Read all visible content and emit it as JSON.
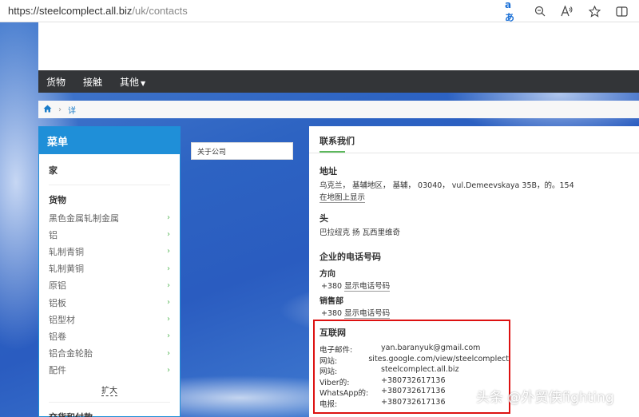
{
  "browser": {
    "url_domain": "https://steelcomplect.all.biz",
    "url_path": "/uk/contacts",
    "icons": [
      "translate-icon",
      "zoom-icon",
      "read-aloud-icon",
      "favorite-icon",
      "split-screen-icon"
    ],
    "translate_label": "aあ"
  },
  "nav": {
    "items": [
      "货物",
      "接触",
      "其他"
    ]
  },
  "breadcrumb": {
    "current": "详"
  },
  "menu": {
    "title": "菜单",
    "home": "家",
    "category": "货物",
    "items": [
      "黑色金属轧制金属",
      "铝",
      "轧制青铜",
      "轧制黄铜",
      "原铝",
      "铝板",
      "铝型材",
      "铝卷",
      "铝合金轮胎",
      "配件"
    ],
    "expand": "扩大",
    "category2": "交货和付款"
  },
  "about": {
    "label": "关于公司"
  },
  "contacts": {
    "title": "联系我们",
    "address_heading": "地址",
    "address": "乌克兰， 基辅地区， 基辅， 03040， vul.Demeevskaya 35B，的。154",
    "map_link": "在地图上显示",
    "head_heading": "头",
    "head_name": "巴拉纽克 扬 瓦西里维奇",
    "phones_heading": "企业的电话号码",
    "direction_label": "方向",
    "direction_prefix": "+380",
    "direction_link": "显示电话号码",
    "sales_label": "销售部",
    "sales_prefix": "+380",
    "sales_link": "显示电话号码",
    "internet_heading": "互联网",
    "internet": [
      {
        "label": "电子邮件:",
        "value": "yan.baranyuk@gmail.com"
      },
      {
        "label": "网站:",
        "value": "sites.google.com/view/steelcomplect"
      },
      {
        "label": "网站:",
        "value": "steelcomplect.all.biz"
      },
      {
        "label": "Viber的:",
        "value": "+380732617136"
      },
      {
        "label": "WhatsApp的:",
        "value": "+380732617136"
      },
      {
        "label": "电报:",
        "value": "+380732617136"
      }
    ]
  },
  "watermark": "头条 @外贸侠fighting",
  "colors": {
    "menu_accent": "#1f8fd8",
    "nav_bg": "#333538",
    "highlight_border": "#dd1111",
    "green_accent": "#5cb85c"
  }
}
